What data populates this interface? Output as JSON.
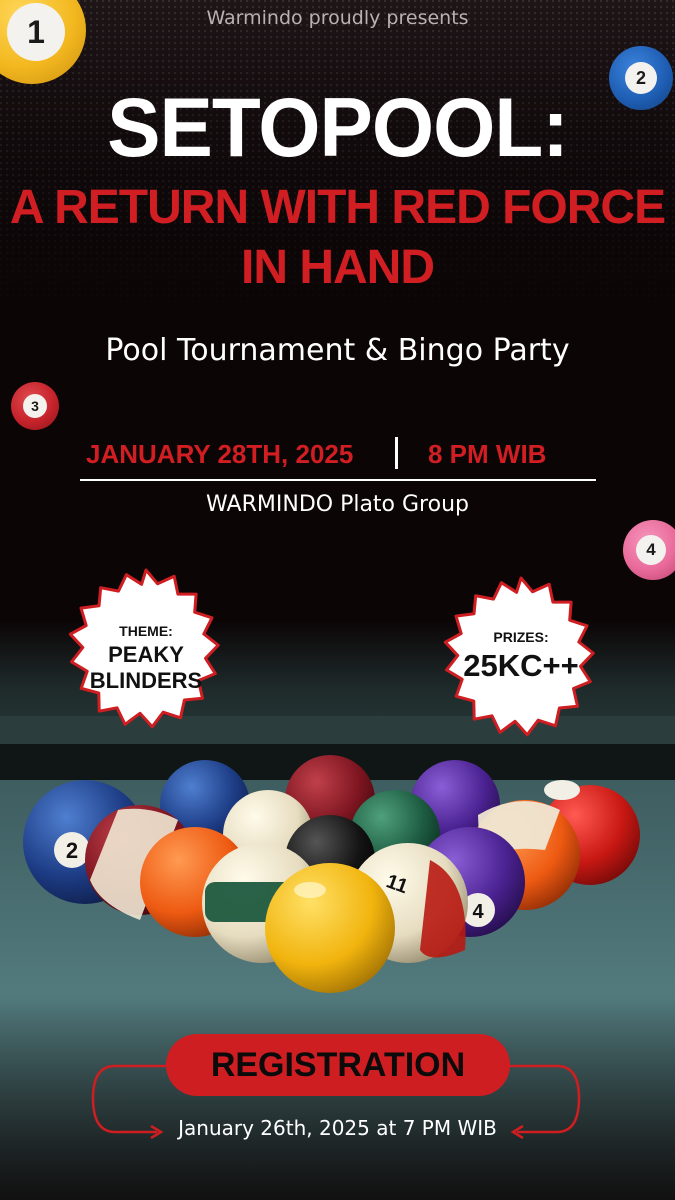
{
  "header": {
    "intro": "Warmindo proudly presents",
    "title": "SETOPOOL:",
    "subtitle_line1": "A RETURN WITH RED FORCE",
    "subtitle_line2": "IN HAND"
  },
  "event": {
    "tagline": "Pool Tournament & Bingo Party",
    "date": "JANUARY 28TH, 2025",
    "time": "8 PM WIB",
    "venue": "WARMINDO Plato Group"
  },
  "corner_balls": [
    {
      "number": "1",
      "color": "#f3b81f"
    },
    {
      "number": "2",
      "color": "#1f5fb5"
    },
    {
      "number": "3",
      "color": "#c6232b"
    },
    {
      "number": "4",
      "color": "#e96a9a"
    }
  ],
  "theme_badge": {
    "label": "THEME:",
    "value_line1": "PEAKY",
    "value_line2": "BLINDERS"
  },
  "prize_badge": {
    "label": "PRIZES:",
    "value": "25KC++"
  },
  "registration": {
    "button_label": "REGISTRATION",
    "date": "January 26th, 2025 at 7 PM WIB"
  },
  "colors": {
    "accent_red": "#d11e22",
    "background": "#0b0506",
    "felt": "#4f7275"
  }
}
